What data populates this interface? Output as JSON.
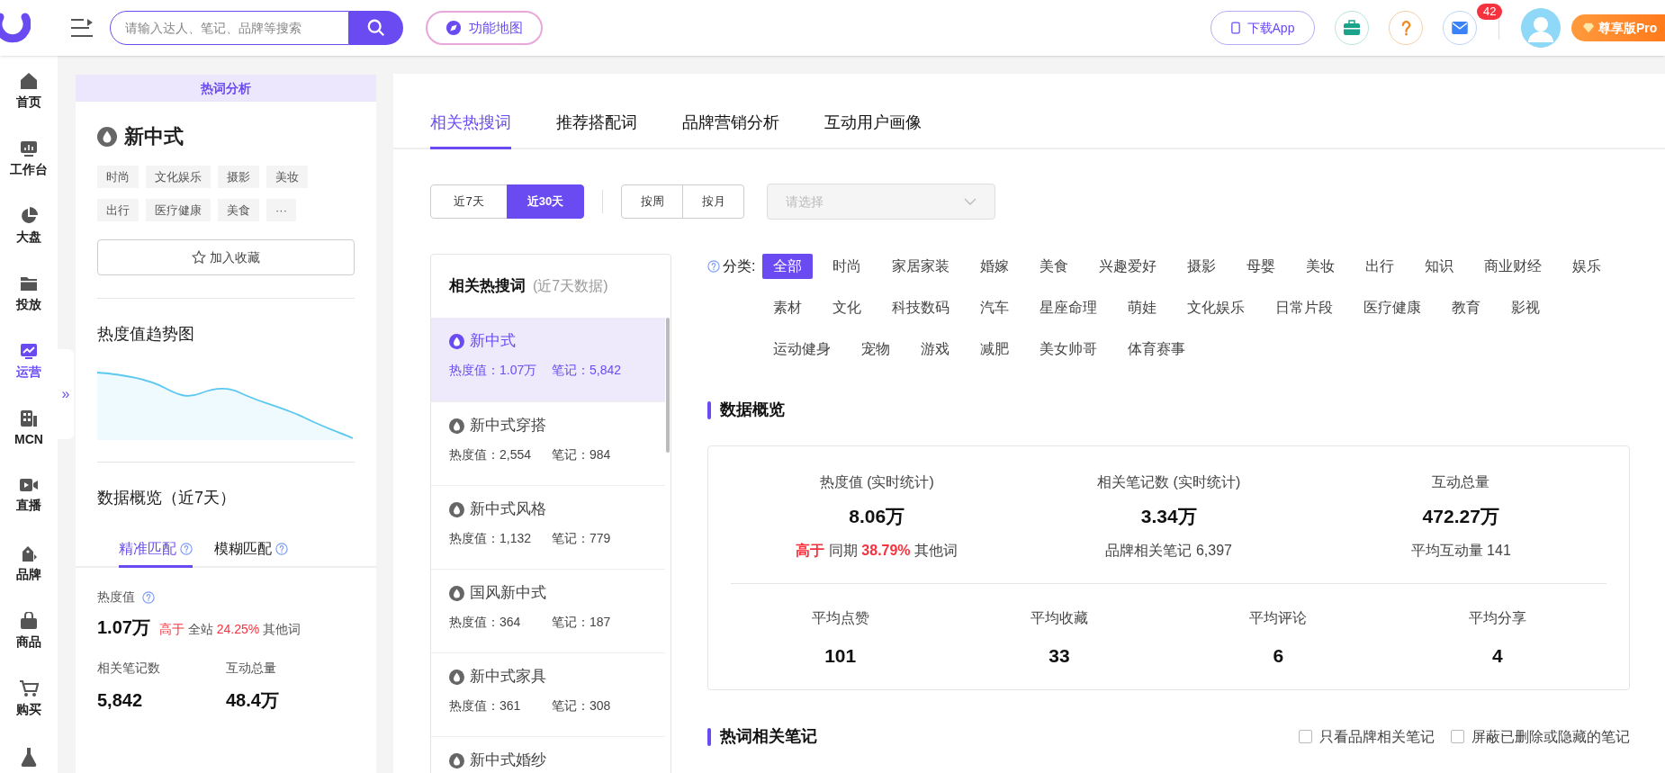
{
  "top_bar": {
    "search": {
      "placeholder": "请输入达人、笔记、品牌等搜索"
    },
    "feature_map_button": "功能地图",
    "download_button": "下载App",
    "message_badge": "42",
    "pro_button": "尊享版Pro"
  },
  "sidebar": {
    "items": [
      {
        "label": "首页",
        "selected": false
      },
      {
        "label": "工作台",
        "selected": false
      },
      {
        "label": "大盘",
        "selected": false
      },
      {
        "label": "投放",
        "selected": false
      },
      {
        "label": "运营",
        "selected": true
      },
      {
        "label": "MCN",
        "selected": false
      },
      {
        "label": "直播",
        "selected": false
      },
      {
        "label": "品牌",
        "selected": false
      },
      {
        "label": "商品",
        "selected": false
      },
      {
        "label": "购买",
        "selected": false
      }
    ],
    "expand_toggle": "»"
  },
  "keyword_panel": {
    "header": "热词分析",
    "keyword": "新中式",
    "tags": [
      "时尚",
      "文化娱乐",
      "摄影",
      "美妆",
      "出行",
      "医疗健康",
      "美食",
      "···"
    ],
    "favorite_button": "加入收藏",
    "trend_title": "热度值趋势图",
    "overview_title": "数据概览（近7天）",
    "match_tabs": [
      {
        "label": "精准匹配",
        "selected": true
      },
      {
        "label": "模糊匹配",
        "selected": false
      }
    ],
    "heat": {
      "label": "热度值",
      "value": "1.07万",
      "compare_word": "高于",
      "scope": "全站",
      "percent": "24.25%",
      "suffix": "其他词"
    },
    "stats": [
      {
        "label": "相关笔记数",
        "value": "5,842"
      },
      {
        "label": "互动总量",
        "value": "48.4万"
      }
    ]
  },
  "main": {
    "tabs": [
      {
        "label": "相关热搜词",
        "selected": true
      },
      {
        "label": "推荐搭配词",
        "selected": false
      },
      {
        "label": "品牌营销分析",
        "selected": false
      },
      {
        "label": "互动用户画像",
        "selected": false
      }
    ],
    "period_buttons": [
      {
        "label": "近7天",
        "selected": false
      },
      {
        "label": "近30天",
        "selected": true
      }
    ],
    "granularity_buttons": [
      {
        "label": "按周",
        "selected": false
      },
      {
        "label": "按月",
        "selected": false
      }
    ],
    "select": {
      "placeholder": "请选择"
    },
    "related_list": {
      "title": "相关热搜词",
      "subtitle": "(近7天数据)",
      "items": [
        {
          "keyword": "新中式",
          "heat": "热度值：1.07万",
          "notes": "笔记：5,842",
          "selected": true
        },
        {
          "keyword": "新中式穿搭",
          "heat": "热度值：2,554",
          "notes": "笔记：984",
          "selected": false
        },
        {
          "keyword": "新中式风格",
          "heat": "热度值：1,132",
          "notes": "笔记：779",
          "selected": false
        },
        {
          "keyword": "国风新中式",
          "heat": "热度值：364",
          "notes": "笔记：187",
          "selected": false
        },
        {
          "keyword": "新中式家具",
          "heat": "热度值：361",
          "notes": "笔记：308",
          "selected": false
        },
        {
          "keyword": "新中式婚纱",
          "selected": false
        }
      ]
    },
    "categories": {
      "label": "分类:",
      "items": [
        {
          "label": "全部",
          "selected": true
        },
        {
          "label": "时尚",
          "selected": false
        },
        {
          "label": "家居家装",
          "selected": false
        },
        {
          "label": "婚嫁",
          "selected": false
        },
        {
          "label": "美食",
          "selected": false
        },
        {
          "label": "兴趣爱好",
          "selected": false
        },
        {
          "label": "摄影",
          "selected": false
        },
        {
          "label": "母婴",
          "selected": false
        },
        {
          "label": "美妆",
          "selected": false
        },
        {
          "label": "出行",
          "selected": false
        },
        {
          "label": "知识",
          "selected": false
        },
        {
          "label": "商业财经",
          "selected": false
        },
        {
          "label": "娱乐",
          "selected": false
        },
        {
          "label": "素材",
          "selected": false
        },
        {
          "label": "文化",
          "selected": false
        },
        {
          "label": "科技数码",
          "selected": false
        },
        {
          "label": "汽车",
          "selected": false
        },
        {
          "label": "星座命理",
          "selected": false
        },
        {
          "label": "萌娃",
          "selected": false
        },
        {
          "label": "文化娱乐",
          "selected": false
        },
        {
          "label": "日常片段",
          "selected": false
        },
        {
          "label": "医疗健康",
          "selected": false
        },
        {
          "label": "教育",
          "selected": false
        },
        {
          "label": "影视",
          "selected": false
        },
        {
          "label": "运动健身",
          "selected": false
        },
        {
          "label": "宠物",
          "selected": false
        },
        {
          "label": "游戏",
          "selected": false
        },
        {
          "label": "减肥",
          "selected": false
        },
        {
          "label": "美女帅哥",
          "selected": false
        },
        {
          "label": "体育赛事",
          "selected": false
        }
      ]
    },
    "overview": {
      "title": "数据概览",
      "top_metrics": [
        {
          "label": "热度值 (实时统计)",
          "value": "8.06万",
          "kind": "compare",
          "compare_word": "高于",
          "scope": "同期",
          "percent": "38.79%",
          "suffix": "其他词"
        },
        {
          "label": "相关笔记数 (实时统计)",
          "value": "3.34万",
          "kind": "note",
          "note": "品牌相关笔记 6,397"
        },
        {
          "label": "互动总量",
          "value": "472.27万",
          "kind": "note",
          "note": "平均互动量 141"
        }
      ],
      "bottom_metrics": [
        {
          "label": "平均点赞",
          "value": "101"
        },
        {
          "label": "平均收藏",
          "value": "33"
        },
        {
          "label": "平均评论",
          "value": "6"
        },
        {
          "label": "平均分享",
          "value": "4"
        }
      ]
    },
    "notes_section": {
      "title": "热词相关笔记",
      "filters": [
        {
          "label": "只看品牌相关笔记",
          "checked": false
        },
        {
          "label": "屏蔽已删除或隐藏的笔记",
          "checked": false
        }
      ]
    }
  }
}
